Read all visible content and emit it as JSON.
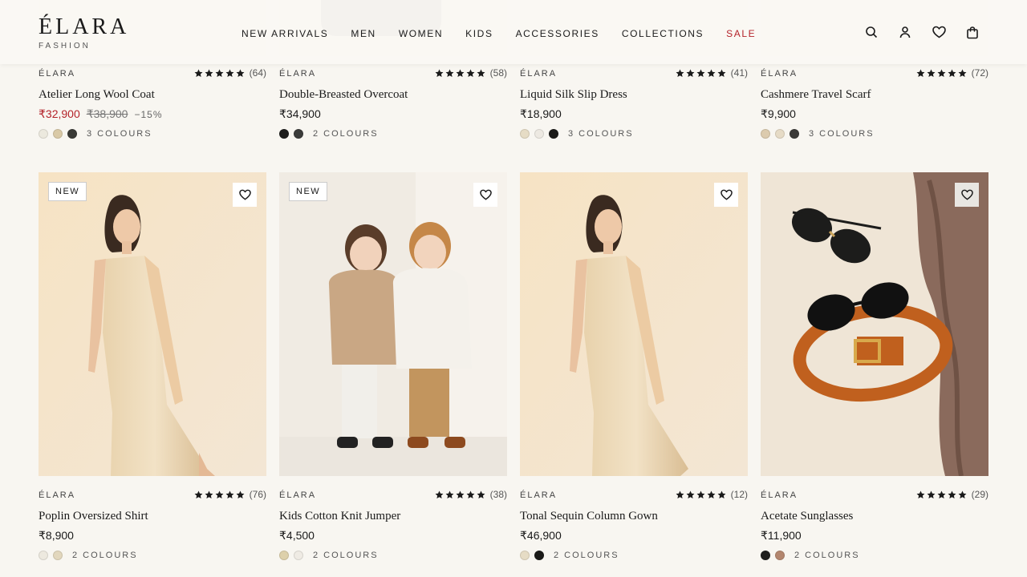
{
  "header": {
    "logo": "ÉLARA",
    "logo_sub": "FASHION",
    "nav": [
      "NEW ARRIVALS",
      "MEN",
      "WOMEN",
      "KIDS",
      "ACCESSORIES",
      "COLLECTIONS",
      "SALE"
    ]
  },
  "top_products": [
    {
      "brand": "ÉLARA",
      "reviews": "(64)",
      "name": "Atelier Long Wool Coat",
      "price": "₹32,900",
      "old_price": "₹38,900",
      "discount": "−15%",
      "colours": "3 COLOURS",
      "swatches": [
        "#ece9de",
        "#d9c9a6",
        "#3a3a36"
      ]
    },
    {
      "brand": "ÉLARA",
      "reviews": "(58)",
      "name": "Double-Breasted Overcoat",
      "price": "₹34,900",
      "colours": "2 COLOURS",
      "swatches": [
        "#1e1e1c",
        "#3b3c3a"
      ]
    },
    {
      "brand": "ÉLARA",
      "reviews": "(41)",
      "name": "Liquid Silk Slip Dress",
      "price": "₹18,900",
      "colours": "3 COLOURS",
      "swatches": [
        "#e6dcc5",
        "#ede9e2",
        "#1a1a18"
      ]
    },
    {
      "brand": "ÉLARA",
      "reviews": "(72)",
      "name": "Cashmere Travel Scarf",
      "price": "₹9,900",
      "colours": "3 COLOURS",
      "swatches": [
        "#dccbae",
        "#e6dbc6",
        "#3b3a38"
      ]
    }
  ],
  "bottom_products": [
    {
      "brand": "ÉLARA",
      "reviews": "(76)",
      "name": "Poplin Oversized Shirt",
      "price": "₹8,900",
      "colours": "2 COLOURS",
      "swatches": [
        "#ede9df",
        "#e2d7bd"
      ],
      "badge": "NEW"
    },
    {
      "brand": "ÉLARA",
      "reviews": "(38)",
      "name": "Kids Cotton Knit Jumper",
      "price": "₹4,500",
      "colours": "2 COLOURS",
      "swatches": [
        "#ddd0ab",
        "#efebe4"
      ],
      "badge": "NEW"
    },
    {
      "brand": "ÉLARA",
      "reviews": "(12)",
      "name": "Tonal Sequin Column Gown",
      "price": "₹46,900",
      "colours": "2 COLOURS",
      "swatches": [
        "#e6dcc5",
        "#1a1a18"
      ],
      "badge": ""
    },
    {
      "brand": "ÉLARA",
      "reviews": "(29)",
      "name": "Acetate Sunglasses",
      "price": "₹11,900",
      "colours": "2 COLOURS",
      "swatches": [
        "#1f1f1d",
        "#b3866e"
      ],
      "badge": ""
    }
  ],
  "colors": {
    "accent": "#b4232a",
    "background": "#f8f6f1"
  }
}
